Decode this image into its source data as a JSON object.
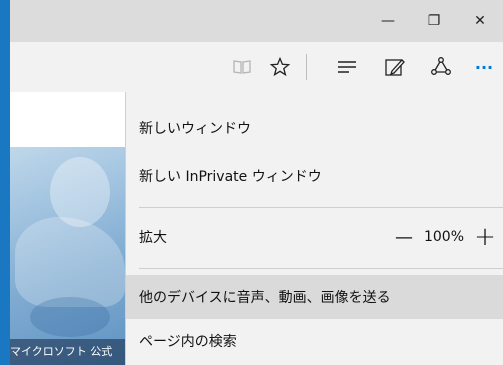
{
  "window": {
    "minimize_glyph": "—",
    "restore_glyph": "❐",
    "close_glyph": "✕"
  },
  "toolbar": {
    "icons": [
      "reading-view-icon",
      "favorites-star-icon",
      "hub-icon",
      "web-note-icon",
      "share-icon",
      "more-actions-icon"
    ],
    "more_glyph": "···",
    "accent_color": "#0078d7"
  },
  "page": {
    "caption": "マイクロソフト 公式"
  },
  "menu": {
    "new_window": "新しいウィンドウ",
    "new_inprivate": "新しい InPrivate ウィンドウ",
    "zoom_label": "拡大",
    "zoom_minus": "—",
    "zoom_value": "100%",
    "zoom_plus": "+",
    "cast": "他のデバイスに音声、動画、画像を送る",
    "find": "ページ内の検索"
  }
}
